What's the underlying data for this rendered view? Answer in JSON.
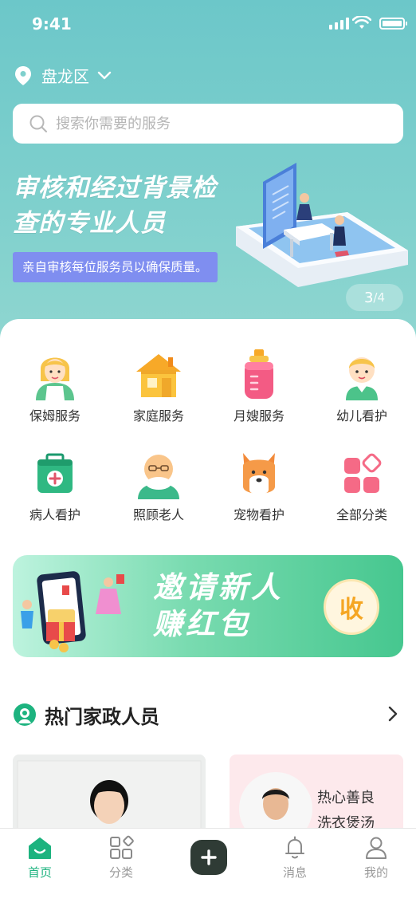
{
  "status_bar": {
    "time": "9:41"
  },
  "location": {
    "district": "盘龙区"
  },
  "search": {
    "placeholder": "搜索你需要的服务"
  },
  "banner": {
    "title": "审核和经过背景检查的专业人员",
    "subtitle": "亲自审核每位服务员以确保质量。",
    "page_current": "3",
    "page_total": "/4"
  },
  "categories": [
    {
      "label": "保姆服务",
      "icon": "nanny-icon"
    },
    {
      "label": "家庭服务",
      "icon": "house-icon"
    },
    {
      "label": "月嫂服务",
      "icon": "baby-bottle-icon"
    },
    {
      "label": "幼儿看护",
      "icon": "child-icon"
    },
    {
      "label": "病人看护",
      "icon": "medical-kit-icon"
    },
    {
      "label": "照顾老人",
      "icon": "elderly-icon"
    },
    {
      "label": "宠物看护",
      "icon": "pet-dog-icon"
    },
    {
      "label": "全部分类",
      "icon": "all-categories-icon"
    }
  ],
  "invite": {
    "line1": "邀请新人",
    "line2": "赚红包",
    "button": "收"
  },
  "hot_section": {
    "title": "热门家政人员"
  },
  "workers": [
    {
      "tags": []
    },
    {
      "tags": [
        "热心善良",
        "洗衣煲汤"
      ]
    }
  ],
  "tabbar": {
    "items": [
      {
        "label": "首页",
        "icon": "home-icon",
        "active": true
      },
      {
        "label": "分类",
        "icon": "category-grid-icon",
        "active": false
      },
      {
        "label": "",
        "icon": "plus-icon",
        "active": false
      },
      {
        "label": "消息",
        "icon": "bell-icon",
        "active": false
      },
      {
        "label": "我的",
        "icon": "user-icon",
        "active": false
      }
    ]
  },
  "colors": {
    "accent": "#1db37f",
    "hero_bg": "#7fd0cd",
    "badge_purple": "#7f8ef0"
  }
}
